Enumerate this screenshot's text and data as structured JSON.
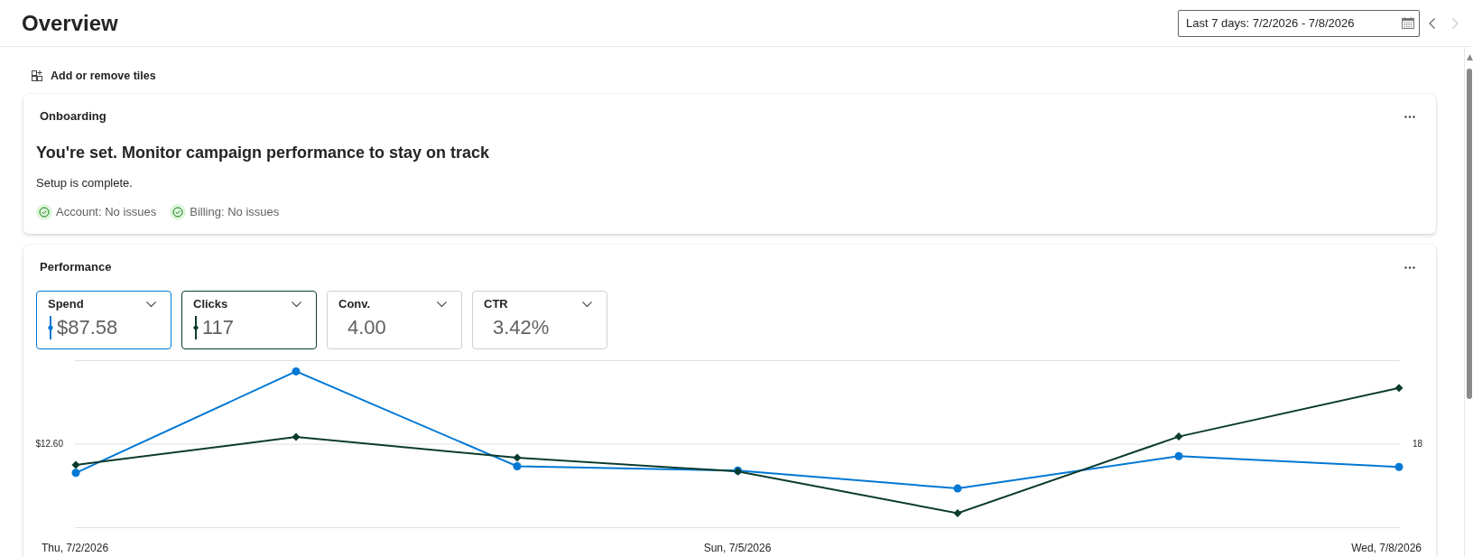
{
  "header": {
    "title": "Overview",
    "date_range": "Last 7 days: 7/2/2026 - 7/8/2026",
    "previous_button": {
      "disabled": false
    },
    "next_button": {
      "disabled": true
    }
  },
  "toolbar": {
    "add_remove_tiles": "Add or remove tiles"
  },
  "onboarding": {
    "title": "Onboarding",
    "headline": "You're set. Monitor campaign performance to stay on track",
    "message": "Setup is complete.",
    "statuses": [
      "Account: No issues",
      "Billing: No issues"
    ]
  },
  "performance": {
    "title": "Performance",
    "tiles": [
      {
        "label": "Spend",
        "value": "$87.58",
        "selected": true,
        "color": "#0078d4"
      },
      {
        "label": "Clicks",
        "value": "117",
        "selected": true,
        "color": "#0b3b2c"
      },
      {
        "label": "Conv.",
        "value": "4.00",
        "selected": false
      },
      {
        "label": "CTR",
        "value": "3.42%",
        "selected": false
      }
    ],
    "chart": {
      "left_axis_tick": "$12.60",
      "right_axis_tick": "18",
      "x_axis_labels": [
        "Thu, 7/2/2026",
        "Sun, 7/5/2026",
        "Wed, 7/8/2026"
      ]
    }
  }
}
